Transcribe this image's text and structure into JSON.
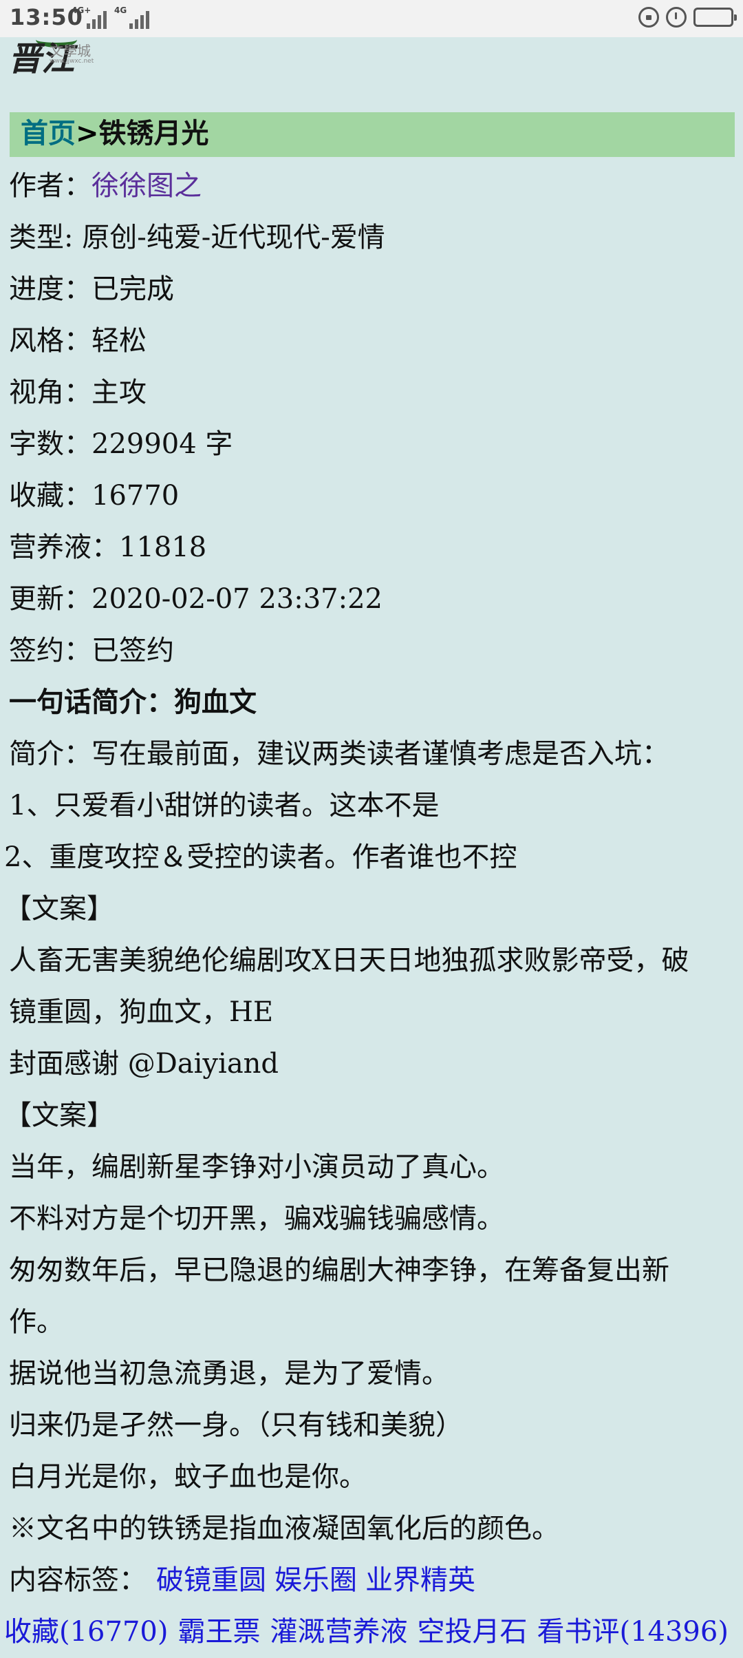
{
  "status_bar": {
    "time": "13:50",
    "signal1": "4G+",
    "signal2": "4G"
  },
  "logo": {
    "glyph": "晋江",
    "site_name": "文學城",
    "site_url": "www.jjwxc.net"
  },
  "breadcrumb": {
    "home": "首页",
    "separator": ">",
    "title": "铁锈月光"
  },
  "info": {
    "author_label": "作者：",
    "author": "徐徐图之",
    "type": "类型: 原创-纯爱-近代现代-爱情",
    "progress": "进度：已完成",
    "style": "风格：轻松",
    "perspective": "视角：主攻",
    "word_count": "字数：229904 字",
    "favorites": "收藏：16770",
    "nutrient": "营养液：11818",
    "updated": "更新：2020-02-07 23:37:22",
    "contract": "签约：已签约",
    "one_liner": "一句话简介：狗血文"
  },
  "intro": {
    "lines": [
      "简介：写在最前面，建议两类读者谨慎考虑是否入坑：",
      "1、只爱看小甜饼的读者。这本不是",
      "2、重度攻控＆受控的读者。作者谁也不控",
      "【文案】",
      "人畜无害美貌绝伦编剧攻X日天日地独孤求败影帝受，破",
      "镜重圆，狗血文，HE",
      "封面感谢 @Daiyiand",
      "【文案】",
      "当年，编剧新星李铮对小演员动了真心。",
      "不料对方是个切开黑，骗戏骗钱骗感情。",
      "匆匆数年后，早已隐退的编剧大神李铮，在筹备复出新",
      "作。",
      "据说他当初急流勇退，是为了爱情。",
      "归来仍是孑然一身。（只有钱和美貌）",
      "白月光是你，蚊子血也是你。",
      "※文名中的铁锈是指血液凝固氧化后的颜色。"
    ]
  },
  "tags": {
    "label": "内容标签：",
    "items": [
      "破镜重圆",
      "娱乐圈",
      "业界精英"
    ]
  },
  "actions": [
    "收藏(16770)",
    "霸王票",
    "灌溉营养液",
    "空投月石",
    "看书评(14396)"
  ]
}
